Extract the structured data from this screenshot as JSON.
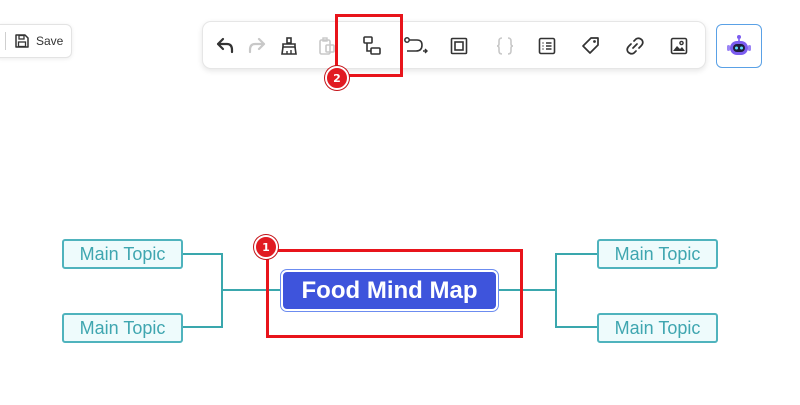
{
  "save_bar": {
    "save_label": "Save"
  },
  "toolbar": {
    "buttons": [
      {
        "icon": "undo-icon",
        "enabled": true
      },
      {
        "icon": "redo-icon",
        "enabled": false
      },
      {
        "icon": "format-painter-icon",
        "enabled": true
      },
      {
        "icon": "clipboard-icon",
        "enabled": false
      },
      {
        "icon": "layout-structure-icon",
        "enabled": true
      },
      {
        "icon": "relationship-icon",
        "enabled": true
      },
      {
        "icon": "boundary-icon",
        "enabled": true
      },
      {
        "icon": "summary-brace-icon",
        "enabled": false
      },
      {
        "icon": "note-list-icon",
        "enabled": true
      },
      {
        "icon": "tag-icon",
        "enabled": true
      },
      {
        "icon": "link-icon",
        "enabled": true
      },
      {
        "icon": "image-icon",
        "enabled": true
      }
    ]
  },
  "ai_button": {
    "icon": "ai-robot-icon"
  },
  "mindmap": {
    "central_topic": "Food Mind Map",
    "topics": [
      "Main Topic",
      "Main Topic",
      "Main Topic",
      "Main Topic"
    ]
  },
  "annotations": {
    "markers": [
      "1",
      "2"
    ],
    "highlight_color": "#e8141b"
  },
  "colors": {
    "central_fill": "#3e54dc",
    "topic_border": "#4fb3bd",
    "topic_fill": "#eefbfc",
    "connector": "#3aa7ad"
  }
}
